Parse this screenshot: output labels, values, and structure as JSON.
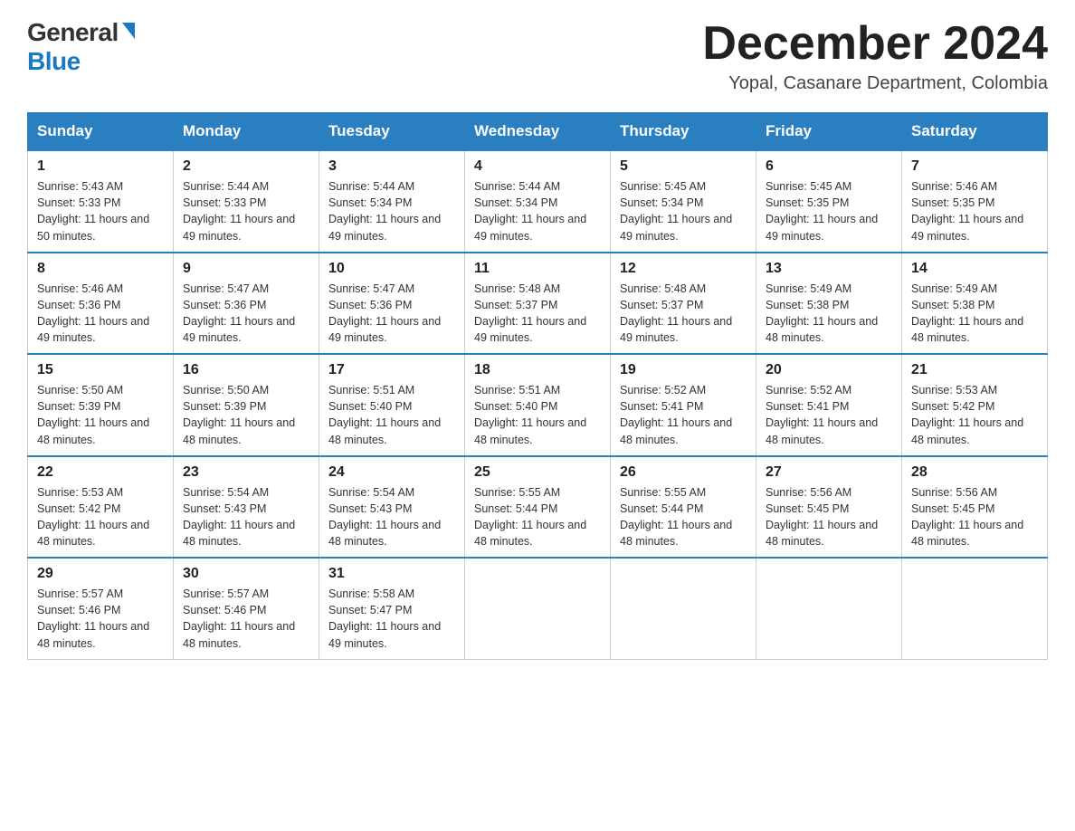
{
  "logo": {
    "general": "General",
    "blue": "Blue"
  },
  "title": "December 2024",
  "location": "Yopal, Casanare Department, Colombia",
  "days_of_week": [
    "Sunday",
    "Monday",
    "Tuesday",
    "Wednesday",
    "Thursday",
    "Friday",
    "Saturday"
  ],
  "weeks": [
    [
      {
        "num": "1",
        "sunrise": "5:43 AM",
        "sunset": "5:33 PM",
        "daylight": "11 hours and 50 minutes."
      },
      {
        "num": "2",
        "sunrise": "5:44 AM",
        "sunset": "5:33 PM",
        "daylight": "11 hours and 49 minutes."
      },
      {
        "num": "3",
        "sunrise": "5:44 AM",
        "sunset": "5:34 PM",
        "daylight": "11 hours and 49 minutes."
      },
      {
        "num": "4",
        "sunrise": "5:44 AM",
        "sunset": "5:34 PM",
        "daylight": "11 hours and 49 minutes."
      },
      {
        "num": "5",
        "sunrise": "5:45 AM",
        "sunset": "5:34 PM",
        "daylight": "11 hours and 49 minutes."
      },
      {
        "num": "6",
        "sunrise": "5:45 AM",
        "sunset": "5:35 PM",
        "daylight": "11 hours and 49 minutes."
      },
      {
        "num": "7",
        "sunrise": "5:46 AM",
        "sunset": "5:35 PM",
        "daylight": "11 hours and 49 minutes."
      }
    ],
    [
      {
        "num": "8",
        "sunrise": "5:46 AM",
        "sunset": "5:36 PM",
        "daylight": "11 hours and 49 minutes."
      },
      {
        "num": "9",
        "sunrise": "5:47 AM",
        "sunset": "5:36 PM",
        "daylight": "11 hours and 49 minutes."
      },
      {
        "num": "10",
        "sunrise": "5:47 AM",
        "sunset": "5:36 PM",
        "daylight": "11 hours and 49 minutes."
      },
      {
        "num": "11",
        "sunrise": "5:48 AM",
        "sunset": "5:37 PM",
        "daylight": "11 hours and 49 minutes."
      },
      {
        "num": "12",
        "sunrise": "5:48 AM",
        "sunset": "5:37 PM",
        "daylight": "11 hours and 49 minutes."
      },
      {
        "num": "13",
        "sunrise": "5:49 AM",
        "sunset": "5:38 PM",
        "daylight": "11 hours and 48 minutes."
      },
      {
        "num": "14",
        "sunrise": "5:49 AM",
        "sunset": "5:38 PM",
        "daylight": "11 hours and 48 minutes."
      }
    ],
    [
      {
        "num": "15",
        "sunrise": "5:50 AM",
        "sunset": "5:39 PM",
        "daylight": "11 hours and 48 minutes."
      },
      {
        "num": "16",
        "sunrise": "5:50 AM",
        "sunset": "5:39 PM",
        "daylight": "11 hours and 48 minutes."
      },
      {
        "num": "17",
        "sunrise": "5:51 AM",
        "sunset": "5:40 PM",
        "daylight": "11 hours and 48 minutes."
      },
      {
        "num": "18",
        "sunrise": "5:51 AM",
        "sunset": "5:40 PM",
        "daylight": "11 hours and 48 minutes."
      },
      {
        "num": "19",
        "sunrise": "5:52 AM",
        "sunset": "5:41 PM",
        "daylight": "11 hours and 48 minutes."
      },
      {
        "num": "20",
        "sunrise": "5:52 AM",
        "sunset": "5:41 PM",
        "daylight": "11 hours and 48 minutes."
      },
      {
        "num": "21",
        "sunrise": "5:53 AM",
        "sunset": "5:42 PM",
        "daylight": "11 hours and 48 minutes."
      }
    ],
    [
      {
        "num": "22",
        "sunrise": "5:53 AM",
        "sunset": "5:42 PM",
        "daylight": "11 hours and 48 minutes."
      },
      {
        "num": "23",
        "sunrise": "5:54 AM",
        "sunset": "5:43 PM",
        "daylight": "11 hours and 48 minutes."
      },
      {
        "num": "24",
        "sunrise": "5:54 AM",
        "sunset": "5:43 PM",
        "daylight": "11 hours and 48 minutes."
      },
      {
        "num": "25",
        "sunrise": "5:55 AM",
        "sunset": "5:44 PM",
        "daylight": "11 hours and 48 minutes."
      },
      {
        "num": "26",
        "sunrise": "5:55 AM",
        "sunset": "5:44 PM",
        "daylight": "11 hours and 48 minutes."
      },
      {
        "num": "27",
        "sunrise": "5:56 AM",
        "sunset": "5:45 PM",
        "daylight": "11 hours and 48 minutes."
      },
      {
        "num": "28",
        "sunrise": "5:56 AM",
        "sunset": "5:45 PM",
        "daylight": "11 hours and 48 minutes."
      }
    ],
    [
      {
        "num": "29",
        "sunrise": "5:57 AM",
        "sunset": "5:46 PM",
        "daylight": "11 hours and 48 minutes."
      },
      {
        "num": "30",
        "sunrise": "5:57 AM",
        "sunset": "5:46 PM",
        "daylight": "11 hours and 48 minutes."
      },
      {
        "num": "31",
        "sunrise": "5:58 AM",
        "sunset": "5:47 PM",
        "daylight": "11 hours and 49 minutes."
      },
      null,
      null,
      null,
      null
    ]
  ]
}
